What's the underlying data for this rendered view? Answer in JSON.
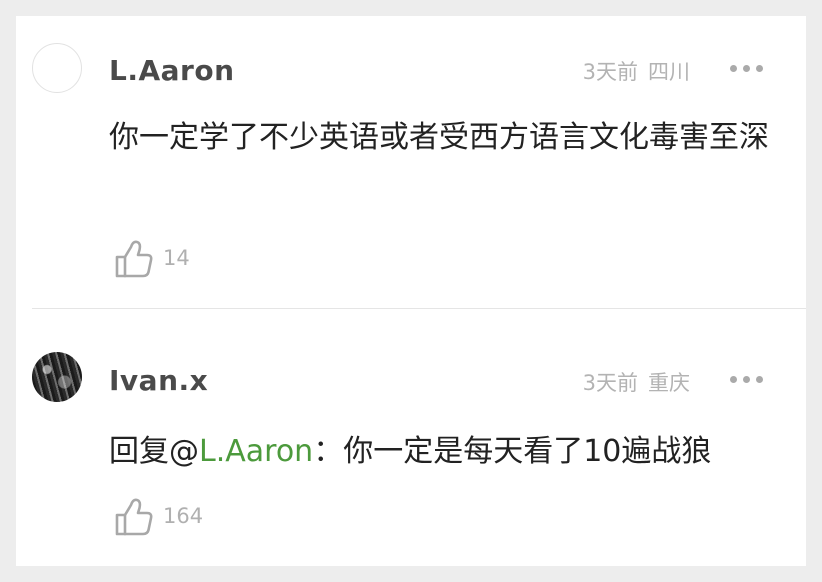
{
  "comments": [
    {
      "username": "L.Aaron",
      "time": "3天前",
      "location": "四川",
      "text": "你一定学了不少英语或者受西方语言文化毒害至深",
      "likes": "14",
      "avatar": "blank-avatar",
      "more_icon": "more-dots-icon",
      "like_icon": "thumbs-up-icon"
    },
    {
      "username": "Ivan.x",
      "time": "3天前",
      "location": "重庆",
      "reply_prefix": "回复@",
      "reply_target": "L.Aaron",
      "reply_sep": "：",
      "text": "你一定是每天看了10遍战狼",
      "likes": "164",
      "avatar": "photo-avatar",
      "more_icon": "more-dots-icon",
      "like_icon": "thumbs-up-icon"
    }
  ],
  "colors": {
    "background": "#ededed",
    "card": "#ffffff",
    "username": "#4a4a4a",
    "meta": "#b3b3b3",
    "content": "#222222",
    "mention": "#4c9a3c",
    "icon": "#a8a8a8"
  }
}
